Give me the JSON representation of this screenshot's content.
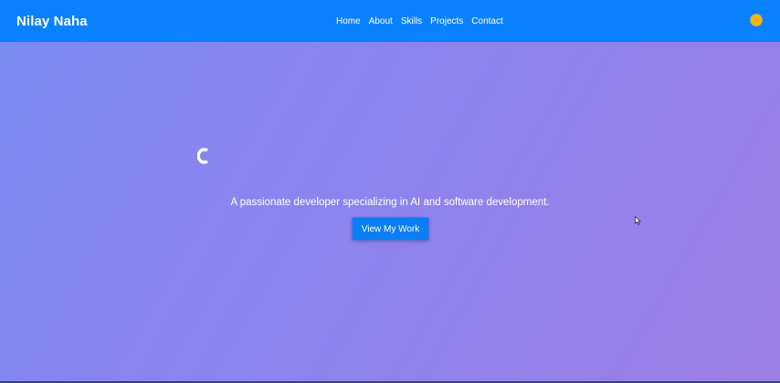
{
  "navbar": {
    "brand": "Nilay Naha",
    "links": [
      "Home",
      "About",
      "Skills",
      "Projects",
      "Contact"
    ],
    "bg_color": "#0a82ff",
    "theme_toggle": {
      "icon": "sun-toggle-icon",
      "color": "#ffb400"
    }
  },
  "hero": {
    "typed_heading": "",
    "subtitle": "A passionate developer specializing in AI and software development.",
    "cta_label": "View My Work",
    "gradient_colors": [
      "#7a8af5",
      "#9b7fe4"
    ]
  },
  "cursor": {
    "icon": "mouse-pointer-icon"
  }
}
